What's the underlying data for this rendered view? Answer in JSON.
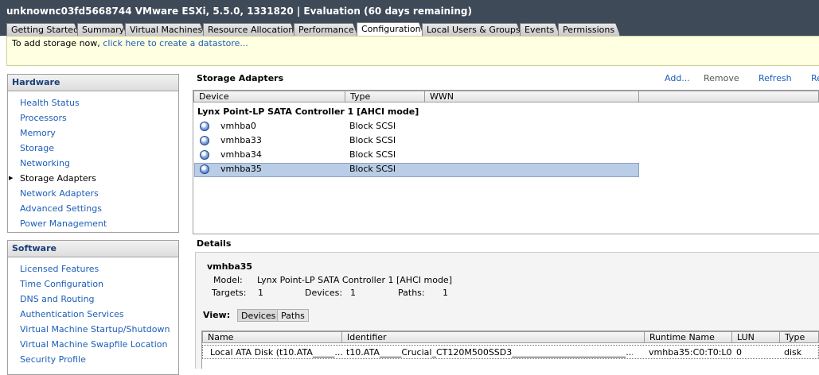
{
  "window": {
    "title": "unknownc03fd5668744 VMware ESXi, 5.5.0, 1331820 | Evaluation (60 days remaining)"
  },
  "tabs": [
    {
      "label": "Getting Started"
    },
    {
      "label": "Summary"
    },
    {
      "label": "Virtual Machines"
    },
    {
      "label": "Resource Allocation"
    },
    {
      "label": "Performance"
    },
    {
      "label": "Configuration"
    },
    {
      "label": "Local Users & Groups"
    },
    {
      "label": "Events"
    },
    {
      "label": "Permissions"
    }
  ],
  "active_tab": "Configuration",
  "infobar": {
    "prefix": "To add storage now, ",
    "link": "click here to create a datastore..."
  },
  "hardware": {
    "title": "Hardware",
    "items": [
      {
        "label": "Health Status"
      },
      {
        "label": "Processors"
      },
      {
        "label": "Memory"
      },
      {
        "label": "Storage"
      },
      {
        "label": "Networking"
      },
      {
        "label": "Storage Adapters"
      },
      {
        "label": "Network Adapters"
      },
      {
        "label": "Advanced Settings"
      },
      {
        "label": "Power Management"
      }
    ],
    "selected": "Storage Adapters"
  },
  "software": {
    "title": "Software",
    "items": [
      {
        "label": "Licensed Features"
      },
      {
        "label": "Time Configuration"
      },
      {
        "label": "DNS and Routing"
      },
      {
        "label": "Authentication Services"
      },
      {
        "label": "Virtual Machine Startup/Shutdown"
      },
      {
        "label": "Virtual Machine Swapfile Location"
      },
      {
        "label": "Security Profile"
      }
    ]
  },
  "adapters": {
    "title": "Storage Adapters",
    "actions": {
      "add": "Add...",
      "remove": "Remove",
      "refresh": "Refresh",
      "rescan": "Re"
    },
    "columns": [
      "Device",
      "Type",
      "WWN"
    ],
    "group": "Lynx Point-LP SATA Controller 1 [AHCI mode]",
    "rows": [
      {
        "device": "vmhba0",
        "type": "Block SCSI"
      },
      {
        "device": "vmhba33",
        "type": "Block SCSI"
      },
      {
        "device": "vmhba34",
        "type": "Block SCSI"
      },
      {
        "device": "vmhba35",
        "type": "Block SCSI"
      }
    ],
    "selected": "vmhba35"
  },
  "details": {
    "title": "Details",
    "name": "vmhba35",
    "model_label": "Model:",
    "model": "Lynx Point-LP SATA Controller 1 [AHCI mode]",
    "targets_label": "Targets:",
    "targets": "1",
    "devices_label": "Devices:",
    "devices": "1",
    "paths_label": "Paths:",
    "paths": "1",
    "view_label": "View:",
    "view_devices": "Devices",
    "view_paths": "Paths",
    "columns": [
      "Name",
      "Identifier",
      "Runtime Name",
      "LUN",
      "Type"
    ],
    "rows": [
      {
        "name": "Local ATA Disk (t10.ATA_____...",
        "identifier": "t10.ATA_____Crucial_CT120M500SSD3__________________________...",
        "runtime": "vmhba35:C0:T0:L0",
        "lun": "0",
        "type": "disk"
      }
    ]
  }
}
